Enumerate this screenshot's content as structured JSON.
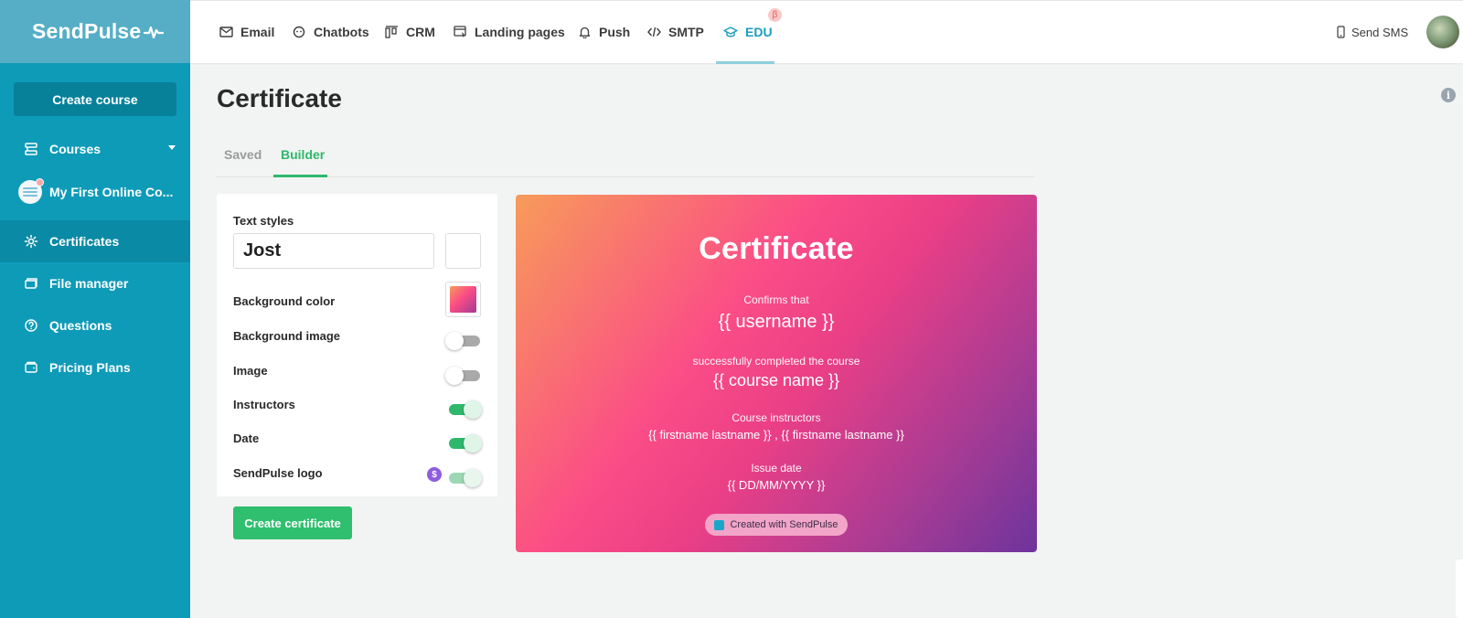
{
  "brand": {
    "name": "SendPulse"
  },
  "sidebar": {
    "create_button": "Create course",
    "items": [
      {
        "label": "Courses",
        "icon": "courses-icon"
      },
      {
        "label": "My First Online Co...",
        "icon": "course-avatar"
      },
      {
        "label": "Certificates",
        "icon": "gear-icon",
        "active": true
      },
      {
        "label": "File manager",
        "icon": "folder-icon"
      },
      {
        "label": "Questions",
        "icon": "question-icon"
      },
      {
        "label": "Pricing Plans",
        "icon": "wallet-icon"
      }
    ]
  },
  "topnav": {
    "items": [
      {
        "label": "Email",
        "icon": "mail-icon"
      },
      {
        "label": "Chatbots",
        "icon": "chatbot-icon"
      },
      {
        "label": "CRM",
        "icon": "crm-icon"
      },
      {
        "label": "Landing pages",
        "icon": "landing-icon"
      },
      {
        "label": "Push",
        "icon": "bell-icon"
      },
      {
        "label": "SMTP",
        "icon": "code-icon"
      },
      {
        "label": "EDU",
        "icon": "graduation-cap-icon",
        "active": true
      }
    ],
    "beta_badge": "β",
    "send_sms": "Send SMS"
  },
  "page": {
    "title": "Certificate",
    "tabs": [
      {
        "label": "Saved"
      },
      {
        "label": "Builder",
        "active": true
      }
    ]
  },
  "builder": {
    "text_styles_label": "Text styles",
    "font_value": "Jost",
    "text_color": "#ffffff",
    "background_color_label": "Background color",
    "background_image_label": "Background image",
    "background_image_on": false,
    "image_label": "Image",
    "image_on": false,
    "instructors_label": "Instructors",
    "instructors_on": true,
    "date_label": "Date",
    "date_on": true,
    "logo_label": "SendPulse logo",
    "logo_on": true,
    "paid_badge": "$",
    "create_button": "Create certificate"
  },
  "certificate": {
    "title": "Certificate",
    "confirms": "Confirms that",
    "username": "{{ username }}",
    "completed": "successfully completed the course",
    "course_name": "{{ course name }}",
    "instructors_label": "Course instructors",
    "instructors": "{{ firstname lastname }} , {{ firstname lastname }}",
    "issue_label": "Issue date",
    "date": "{{ DD/MM/YYYY }}",
    "badge": "Created with SendPulse",
    "gradient_start": "#f79b5a",
    "gradient_mid": "#fb4d86",
    "gradient_end": "#6d349c"
  }
}
